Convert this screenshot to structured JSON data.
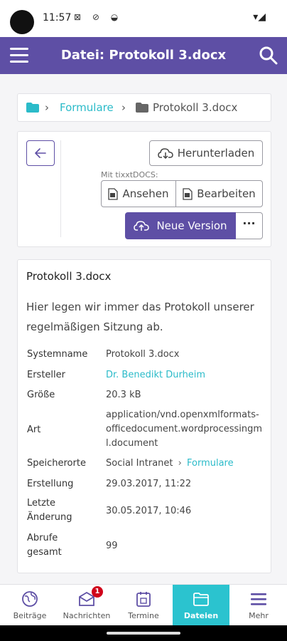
{
  "status": {
    "time": "11:57",
    "icons": "⊠ ⊘ ◒",
    "right": "▾◢"
  },
  "appbar": {
    "title": "Datei: Protokoll 3.docx"
  },
  "breadcrumb": {
    "folder": "Formulare",
    "current": "Protokoll 3.docx"
  },
  "actions": {
    "download": "Herunterladen",
    "with_label": "Mit tixxtDOCS:",
    "view": "Ansehen",
    "edit": "Bearbeiten",
    "new_version": "Neue Version",
    "more": "···"
  },
  "details": {
    "title": "Protokoll 3.docx",
    "description": "Hier legen wir immer das Protokoll unserer regelmäßigen Sitzung ab.",
    "rows": [
      {
        "label": "Systemname",
        "value": "Protokoll 3.docx"
      },
      {
        "label": "Ersteller",
        "value": "Dr. Benedikt Durheim"
      },
      {
        "label": "Größe",
        "value": "20.3 kB"
      },
      {
        "label": "Art",
        "value": "application/vnd.openxmlformats-officedocument.wordprocessingml.document"
      },
      {
        "label": "Speicherorte",
        "value": "Social Intranet",
        "value_link": "Formulare"
      },
      {
        "label": "Erstellung",
        "value": "29.03.2017, 11:22"
      },
      {
        "label": "Letzte Änderung",
        "value": "30.05.2017, 10:46"
      },
      {
        "label": "Abrufe gesamt",
        "value": "99"
      }
    ]
  },
  "nav": {
    "items": [
      {
        "label": "Beiträge",
        "icon": "globe-icon"
      },
      {
        "label": "Nachrichten",
        "icon": "mail-icon",
        "badge": "1"
      },
      {
        "label": "Termine",
        "icon": "calendar-icon"
      },
      {
        "label": "Dateien",
        "icon": "folder-icon",
        "active": true
      },
      {
        "label": "Mehr",
        "icon": "menu-icon"
      }
    ]
  },
  "colors": {
    "brand": "#5e4fa5",
    "accent": "#2bc3cf",
    "link": "#2bbbc9",
    "badge": "#d0021b"
  }
}
